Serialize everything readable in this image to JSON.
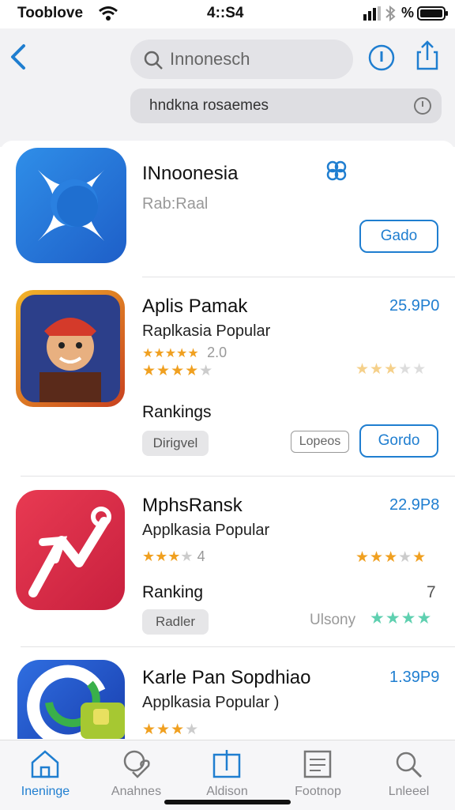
{
  "status": {
    "carrier": "Tooblove",
    "time": "4::S4",
    "battery_pct": "%"
  },
  "header": {
    "search_text": "Innonesch",
    "filter_text": "hndkna rosaemes"
  },
  "apps": [
    {
      "title": "INnoonesia",
      "subtitle": "Rab:Raal",
      "action": "Gado"
    },
    {
      "title": "Aplis Pamak",
      "subtitle": "Raplkasia Popular",
      "price": "25.9P0",
      "rating_count": "2.0",
      "ranking": "Rankings",
      "tag": "Dirigvel",
      "badge": "Lopeos",
      "action": "Gordo"
    },
    {
      "title": "MphsRansk",
      "subtitle": "Applkasia Popular",
      "price": "22.9P8",
      "rating_left": "4",
      "ranking": "Ranking",
      "rank_num": "7",
      "tag": "Radler",
      "right_label": "Ulsony"
    },
    {
      "title": "Karle Pan Sopdhiao",
      "subtitle": "Applkasia Popular )",
      "price": "1.39P9"
    }
  ],
  "tabs": [
    {
      "label": "Ineninge",
      "icon": "home-icon",
      "active": true
    },
    {
      "label": "Anahnes",
      "icon": "heart-chat-icon",
      "active": false
    },
    {
      "label": "Aldison",
      "icon": "board-icon",
      "active": false
    },
    {
      "label": "Footnop",
      "icon": "news-icon",
      "active": false
    },
    {
      "label": "Lnleeel",
      "icon": "search-icon",
      "active": false
    }
  ],
  "colors": {
    "accent": "#1f7ed0",
    "star": "#f0a020",
    "star_green": "#5fd0b0"
  }
}
